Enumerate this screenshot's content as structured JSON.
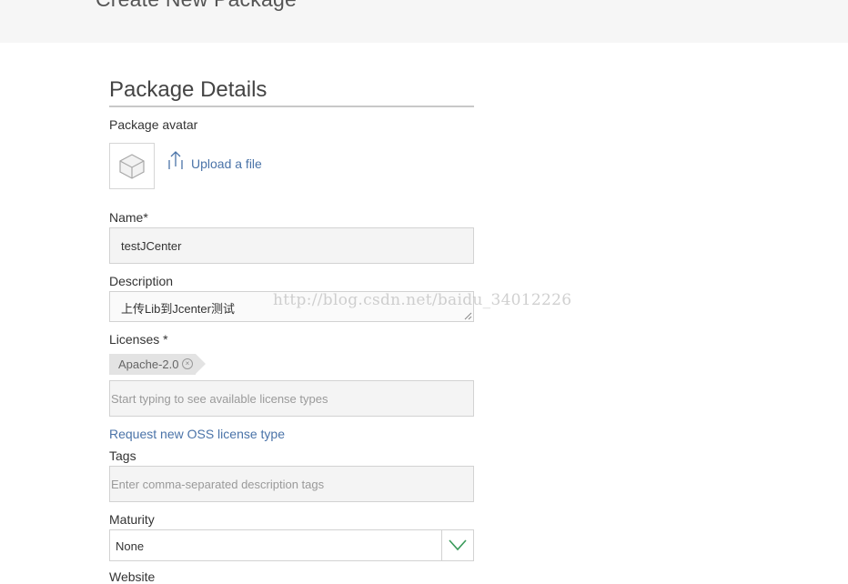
{
  "header": {
    "title": "Create New Package"
  },
  "section": {
    "title": "Package Details"
  },
  "avatar": {
    "label": "Package avatar",
    "upload_label": "Upload a file"
  },
  "name": {
    "label": "Name*",
    "value": "testJCenter"
  },
  "description": {
    "label": "Description",
    "value": "上传Lib到Jcenter测试"
  },
  "licenses": {
    "label": "Licenses *",
    "selected": [
      "Apache-2.0"
    ],
    "placeholder": "Start typing to see available license types",
    "request_link": "Request new OSS license type"
  },
  "tags": {
    "label": "Tags",
    "placeholder": "Enter comma-separated description tags"
  },
  "maturity": {
    "label": "Maturity",
    "value": "None"
  },
  "website": {
    "label": "Website"
  },
  "watermark": "http://blog.csdn.net/baidu_34012226",
  "colors": {
    "link": "#4a73a8",
    "accent_green": "#3a9a5a",
    "field_bg": "#f4f4f4"
  }
}
